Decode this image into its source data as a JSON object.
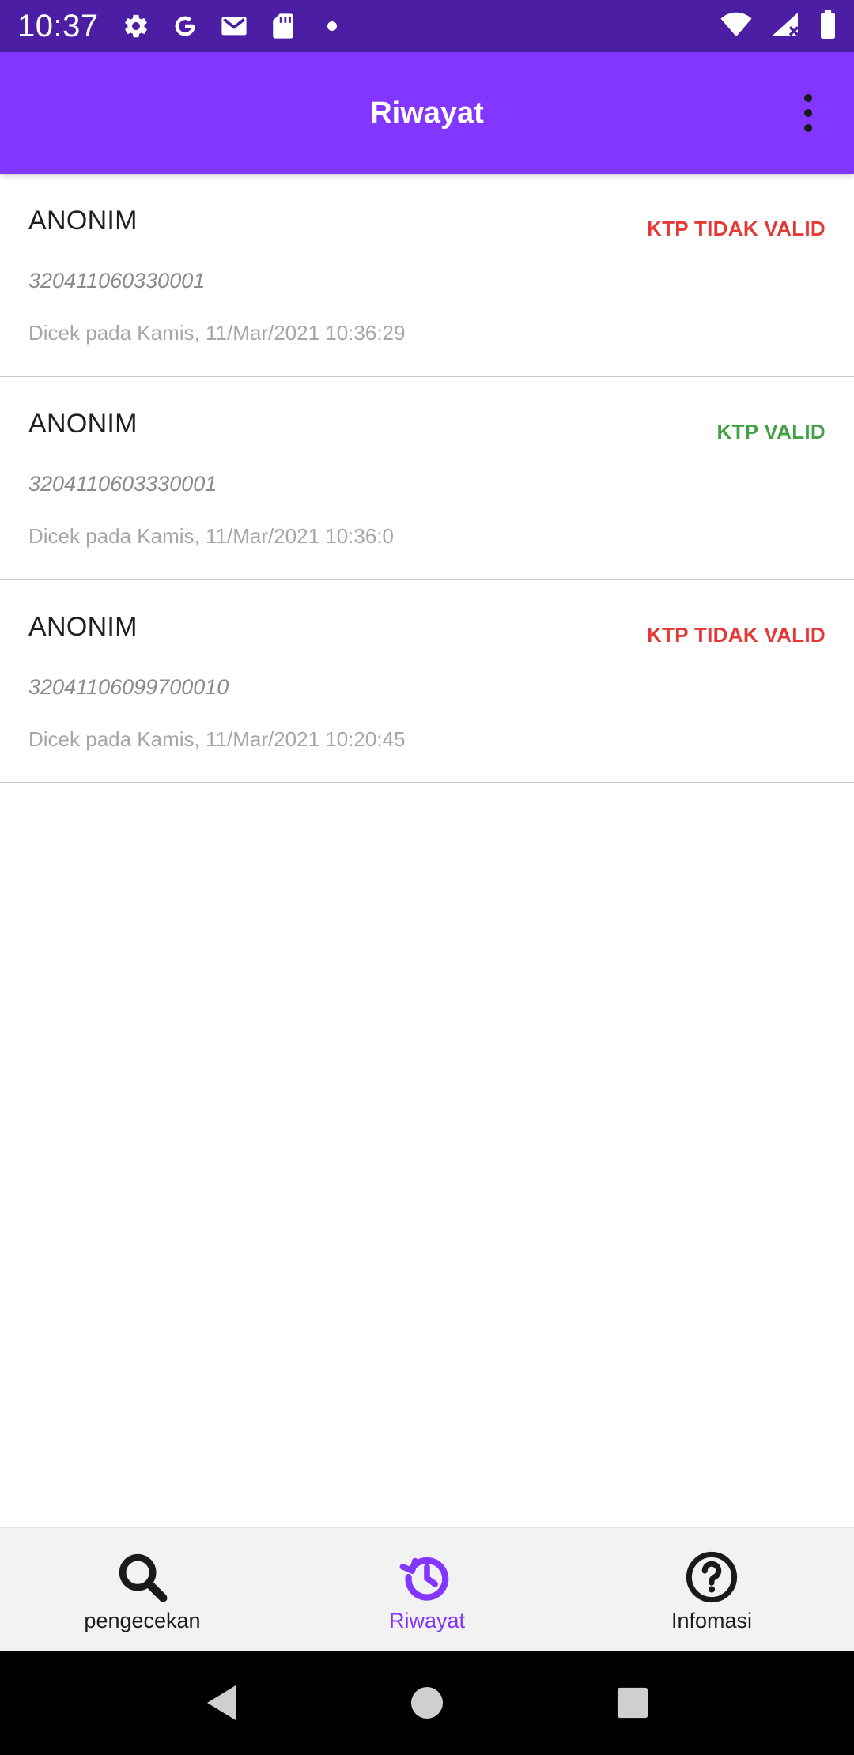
{
  "status_bar": {
    "time": "10:37",
    "icons_left": [
      "settings-icon",
      "google-icon",
      "gmail-icon",
      "sd-card-icon",
      "dot-icon"
    ],
    "icons_right": [
      "wifi-icon",
      "signal-icon",
      "battery-icon"
    ]
  },
  "app_bar": {
    "title": "Riwayat",
    "menu_icon": "more-vert-icon"
  },
  "colors": {
    "status_bar": "#4b1ea3",
    "app_bar": "#8236ff",
    "invalid": "#e53935",
    "valid": "#43a047",
    "nav_active": "#8236ff"
  },
  "history": [
    {
      "name": "ANONIM",
      "status": "KTP TIDAK VALID",
      "valid": false,
      "number": "320411060330001",
      "checked": "Dicek pada Kamis, 11/Mar/2021 10:36:29"
    },
    {
      "name": "ANONIM",
      "status": "KTP VALID",
      "valid": true,
      "number": "3204110603330001",
      "checked": "Dicek pada Kamis, 11/Mar/2021 10:36:0"
    },
    {
      "name": "ANONIM",
      "status": "KTP TIDAK VALID",
      "valid": false,
      "number": "32041106099700010",
      "checked": "Dicek pada Kamis, 11/Mar/2021 10:20:45"
    }
  ],
  "bottom_nav": {
    "items": [
      {
        "label": "pengecekan",
        "icon": "search-icon",
        "active": false
      },
      {
        "label": "Riwayat",
        "icon": "history-icon",
        "active": true
      },
      {
        "label": "Infomasi",
        "icon": "help-circle-icon",
        "active": false
      }
    ]
  },
  "system_nav": {
    "icons": [
      "back-icon",
      "home-icon",
      "recents-icon"
    ]
  }
}
